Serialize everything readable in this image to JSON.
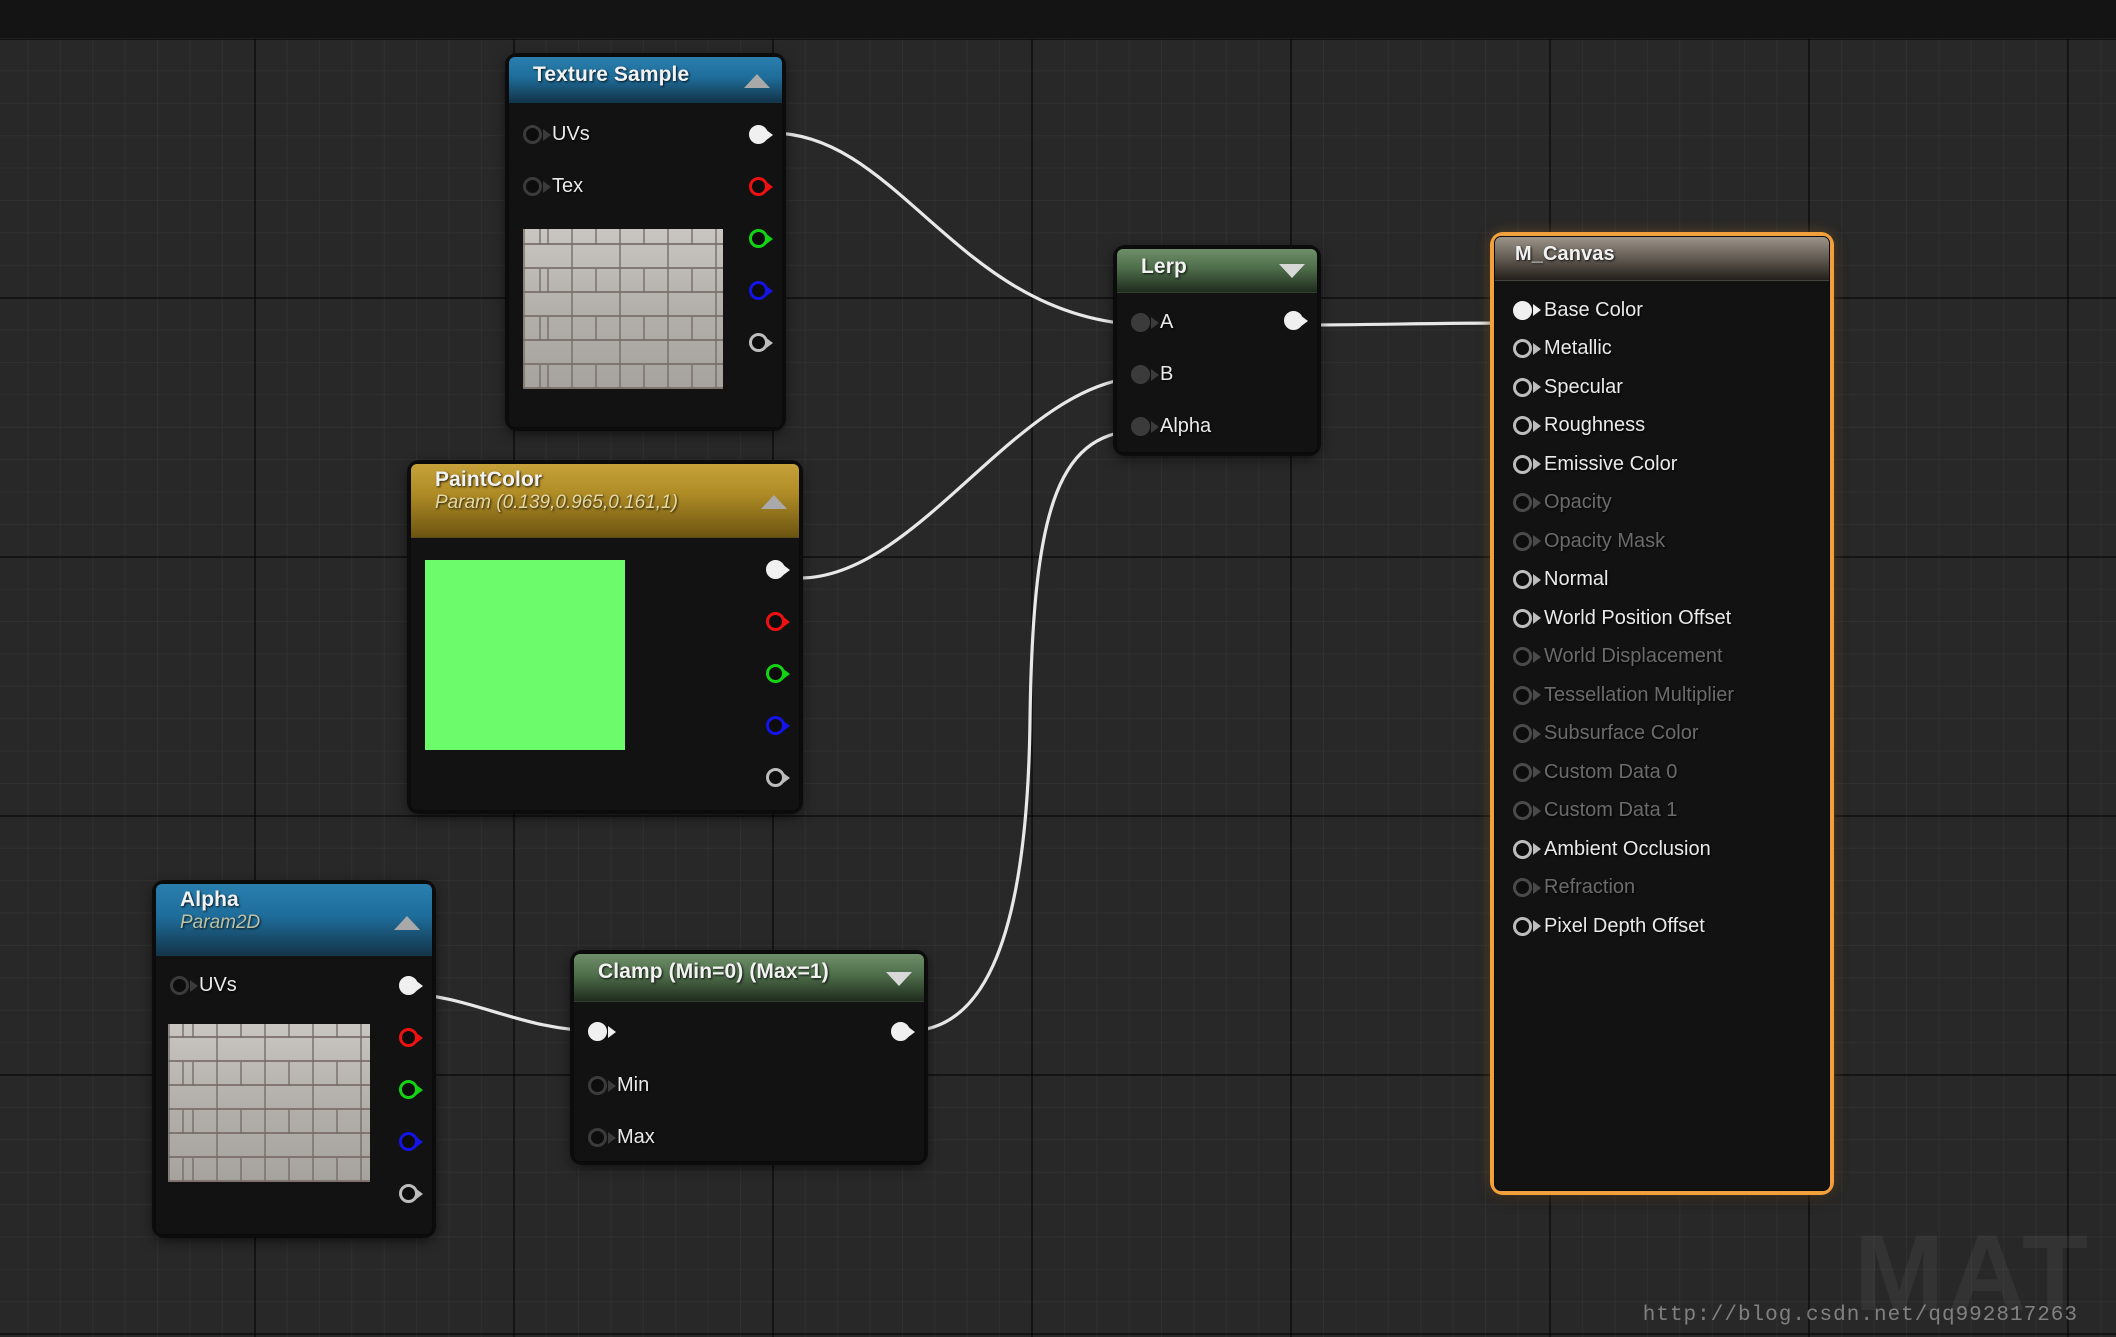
{
  "editor": {
    "name": "unreal-material-graph",
    "background_color": "#282828",
    "grid_minor_color": "#303030",
    "grid_major_color": "#000000"
  },
  "nodes": {
    "texture_sample": {
      "title": "Texture Sample",
      "header_color": "#1e6d9b",
      "collapse_icon": "triangle-up-icon",
      "inputs": [
        {
          "label": "UVs",
          "pin": "hollow-dark"
        },
        {
          "label": "Tex",
          "pin": "hollow-dark"
        }
      ],
      "outputs": [
        {
          "label": "",
          "pin": "filled-white",
          "connected": true
        },
        {
          "label": "",
          "pin": "hollow-red",
          "connected": false
        },
        {
          "label": "",
          "pin": "hollow-green",
          "connected": false
        },
        {
          "label": "",
          "pin": "hollow-blue",
          "connected": false
        },
        {
          "label": "",
          "pin": "hollow-grey",
          "connected": false
        }
      ],
      "preview": "brick-texture-thumbnail"
    },
    "paint_color": {
      "title": "PaintColor",
      "subtitle": "Param (0.139,0.965,0.161,1)",
      "header_color": "#b08c26",
      "collapse_icon": "triangle-up-icon",
      "swatch_color": "#6bfb6b",
      "outputs": [
        {
          "label": "",
          "pin": "filled-white",
          "connected": true
        },
        {
          "label": "",
          "pin": "hollow-red",
          "connected": false
        },
        {
          "label": "",
          "pin": "hollow-green",
          "connected": false
        },
        {
          "label": "",
          "pin": "hollow-blue",
          "connected": false
        },
        {
          "label": "",
          "pin": "hollow-grey",
          "connected": false
        }
      ]
    },
    "alpha": {
      "title": "Alpha",
      "subtitle": "Param2D",
      "header_color": "#1e6d9b",
      "collapse_icon": "triangle-up-icon",
      "inputs": [
        {
          "label": "UVs",
          "pin": "hollow-dark"
        }
      ],
      "outputs": [
        {
          "label": "",
          "pin": "filled-white",
          "connected": true
        },
        {
          "label": "",
          "pin": "hollow-red",
          "connected": false
        },
        {
          "label": "",
          "pin": "hollow-green",
          "connected": false
        },
        {
          "label": "",
          "pin": "hollow-blue",
          "connected": false
        },
        {
          "label": "",
          "pin": "hollow-grey",
          "connected": false
        }
      ],
      "preview": "brick-texture-thumbnail"
    },
    "clamp": {
      "title": "Clamp (Min=0) (Max=1)",
      "header_color": "#4e6d4a",
      "collapse_icon": "triangle-down-icon",
      "inputs": [
        {
          "label": "",
          "pin": "filled-white",
          "connected": true
        },
        {
          "label": "Min",
          "pin": "hollow-dark"
        },
        {
          "label": "Max",
          "pin": "hollow-dark"
        }
      ],
      "outputs": [
        {
          "label": "",
          "pin": "filled-white",
          "connected": true
        }
      ]
    },
    "lerp": {
      "title": "Lerp",
      "header_color": "#4e6d4a",
      "collapse_icon": "triangle-down-icon",
      "inputs": [
        {
          "label": "A",
          "pin": "filled-dark",
          "connected": true
        },
        {
          "label": "B",
          "pin": "filled-dark",
          "connected": true
        },
        {
          "label": "Alpha",
          "pin": "filled-dark",
          "connected": true
        }
      ],
      "outputs": [
        {
          "label": "",
          "pin": "filled-white",
          "connected": true
        }
      ]
    },
    "m_canvas": {
      "title": "M_Canvas",
      "header_color": "#6d665d",
      "border_color": "#f2a03c",
      "inputs": [
        {
          "label": "Base Color",
          "pin": "filled-white",
          "enabled": true,
          "connected": true
        },
        {
          "label": "Metallic",
          "pin": "hollow-grey",
          "enabled": true,
          "connected": false
        },
        {
          "label": "Specular",
          "pin": "hollow-grey",
          "enabled": true,
          "connected": false
        },
        {
          "label": "Roughness",
          "pin": "hollow-grey",
          "enabled": true,
          "connected": false
        },
        {
          "label": "Emissive Color",
          "pin": "hollow-grey",
          "enabled": true,
          "connected": false
        },
        {
          "label": "Opacity",
          "pin": "hollow-dim",
          "enabled": false,
          "connected": false
        },
        {
          "label": "Opacity Mask",
          "pin": "hollow-dim",
          "enabled": false,
          "connected": false
        },
        {
          "label": "Normal",
          "pin": "hollow-grey",
          "enabled": true,
          "connected": false
        },
        {
          "label": "World Position Offset",
          "pin": "hollow-grey",
          "enabled": true,
          "connected": false
        },
        {
          "label": "World Displacement",
          "pin": "hollow-dim",
          "enabled": false,
          "connected": false
        },
        {
          "label": "Tessellation Multiplier",
          "pin": "hollow-dim",
          "enabled": false,
          "connected": false
        },
        {
          "label": "Subsurface Color",
          "pin": "hollow-dim",
          "enabled": false,
          "connected": false
        },
        {
          "label": "Custom Data 0",
          "pin": "hollow-dim",
          "enabled": false,
          "connected": false
        },
        {
          "label": "Custom Data 1",
          "pin": "hollow-dim",
          "enabled": false,
          "connected": false
        },
        {
          "label": "Ambient Occlusion",
          "pin": "hollow-grey",
          "enabled": true,
          "connected": false
        },
        {
          "label": "Refraction",
          "pin": "hollow-dim",
          "enabled": false,
          "connected": false
        },
        {
          "label": "Pixel Depth Offset",
          "pin": "hollow-grey",
          "enabled": true,
          "connected": false
        }
      ]
    }
  },
  "watermark": {
    "big_text": "MAT",
    "url": "http://blog.csdn.net/qq992817263"
  }
}
